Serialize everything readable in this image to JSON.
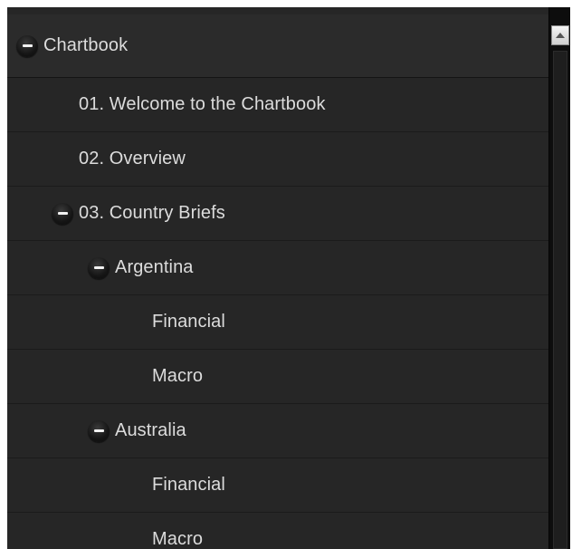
{
  "tree": {
    "root": {
      "label": "Chartbook",
      "toggle_icon": "minus-icon",
      "expanded": true
    },
    "items": [
      {
        "label": "01. Welcome to the Chartbook"
      },
      {
        "label": "02. Overview"
      },
      {
        "label": "03. Country Briefs",
        "toggle_icon": "minus-icon",
        "expanded": true
      },
      {
        "label": "Argentina",
        "toggle_icon": "minus-icon",
        "expanded": true
      },
      {
        "label": "Financial"
      },
      {
        "label": "Macro"
      },
      {
        "label": "Australia",
        "toggle_icon": "minus-icon",
        "expanded": true
      },
      {
        "label": "Financial"
      },
      {
        "label": "Macro"
      }
    ]
  },
  "scrollbar": {
    "up_icon": "arrow-up-icon"
  },
  "colors": {
    "panel_bg": "#262626",
    "root_bg": "#2b2b2b",
    "text": "#dcdcdc",
    "scroll_track": "#0d0d0d"
  }
}
